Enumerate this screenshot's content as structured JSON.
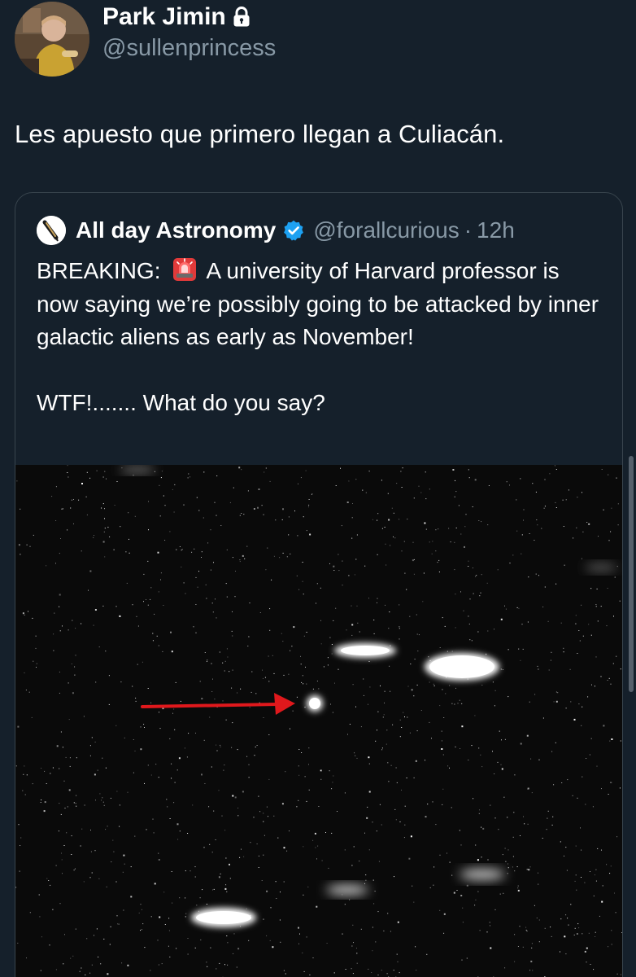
{
  "tweet": {
    "author": {
      "display_name": "Park Jimin",
      "handle": "@sullenprincess",
      "protected_icon": "lock-icon"
    },
    "text": "Les apuesto que primero llegan a Culiacán."
  },
  "quote": {
    "author": {
      "display_name": "All day Astronomy",
      "handle": "@forallcurious",
      "separator": "·",
      "time": "12h",
      "verified_icon": "verified-badge-icon"
    },
    "body_line1_before_emoji": "BREAKING:",
    "body_line1_after_emoji": "A university of Harvard professor is now saying we’re possibly going to be attacked by inner galactic aliens as early as November!",
    "body_line2": "WTF!....... What do you say?",
    "emoji_icon": "police-siren-icon"
  },
  "colors": {
    "background": "#15202b",
    "text_primary": "#ffffff",
    "text_secondary": "#8899a6",
    "border": "#38444d",
    "verified": "#1da1f2",
    "arrow": "#e0181c"
  }
}
